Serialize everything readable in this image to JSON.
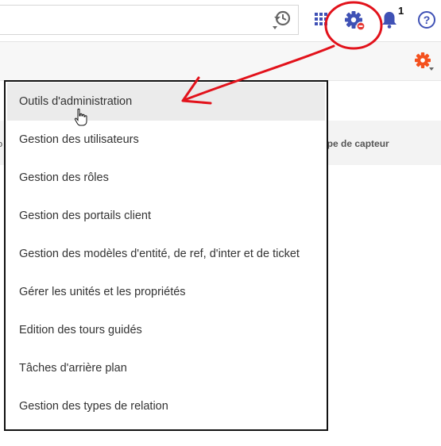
{
  "toolbar": {
    "icons": [
      "history-icon",
      "apps-grid-icon",
      "settings-gear-icon",
      "bell-icon",
      "help-icon"
    ],
    "notification_count": "1",
    "help_label": "?"
  },
  "table": {
    "left_column_fragment": "o",
    "type_column": "ype de capteur"
  },
  "menu": {
    "items": [
      "Outils d'administration",
      "Gestion des utilisateurs",
      "Gestion des rôles",
      "Gestion des portails client",
      "Gestion des modèles d'entité, de ref, d'inter et de ticket",
      "Gérer les unités et les propriétés",
      "Edition des tours guidés",
      "Tâches d'arrière plan",
      "Gestion des types de relation"
    ],
    "active_index": 0
  },
  "colors": {
    "gear_blue": "#3f51b5",
    "gear_badge_red": "#e53935",
    "orange_gear": "#f4511e",
    "annotation_red": "#e2121b"
  }
}
